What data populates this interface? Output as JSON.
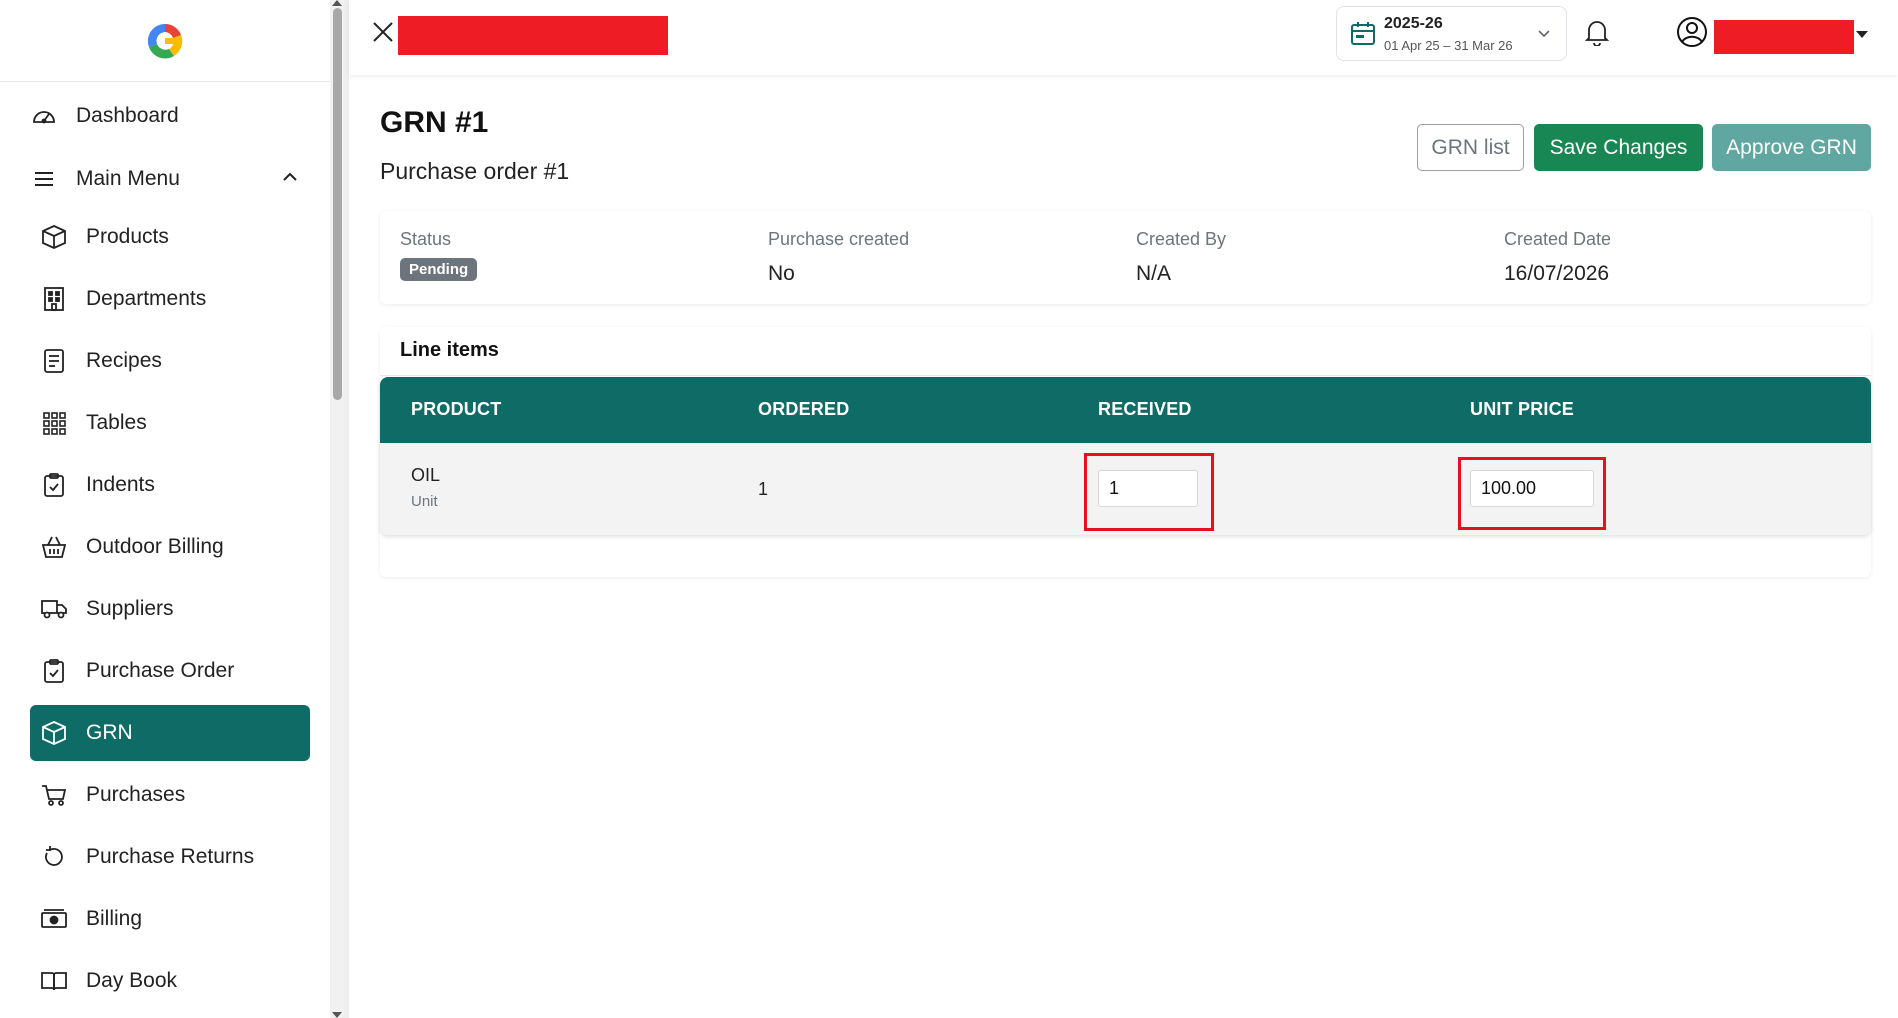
{
  "sidebar": {
    "dashboard": "Dashboard",
    "main_menu": "Main Menu",
    "items": [
      {
        "label": "Products",
        "icon": "box-icon"
      },
      {
        "label": "Departments",
        "icon": "building-icon"
      },
      {
        "label": "Recipes",
        "icon": "recipe-icon"
      },
      {
        "label": "Tables",
        "icon": "grid-icon"
      },
      {
        "label": "Indents",
        "icon": "clipboard-icon"
      },
      {
        "label": "Outdoor Billing",
        "icon": "basket-icon"
      },
      {
        "label": "Suppliers",
        "icon": "truck-icon"
      },
      {
        "label": "Purchase Order",
        "icon": "clipboard-check-icon"
      },
      {
        "label": "GRN",
        "icon": "box-icon",
        "active": true
      },
      {
        "label": "Purchases",
        "icon": "cart-icon"
      },
      {
        "label": "Purchase Returns",
        "icon": "return-icon"
      },
      {
        "label": "Billing",
        "icon": "cash-icon"
      },
      {
        "label": "Day Book",
        "icon": "book-icon"
      }
    ]
  },
  "topbar": {
    "fy_title": "2025-26",
    "fy_range": "01 Apr 25 – 31 Mar 26"
  },
  "page": {
    "title": "GRN #1",
    "subtitle": "Purchase order #1",
    "buttons": {
      "grn_list": "GRN list",
      "save": "Save Changes",
      "approve": "Approve GRN"
    }
  },
  "info": {
    "status_label": "Status",
    "status_value": "Pending",
    "purchase_created_label": "Purchase created",
    "purchase_created_value": "No",
    "created_by_label": "Created By",
    "created_by_value": "N/A",
    "created_date_label": "Created Date",
    "created_date_value": "16/07/2026"
  },
  "line_items": {
    "title": "Line items",
    "columns": [
      "PRODUCT",
      "ORDERED",
      "RECEIVED",
      "UNIT PRICE"
    ],
    "rows": [
      {
        "product": "OIL",
        "unit": "Unit",
        "ordered": "1",
        "received": "1",
        "unit_price": "100.00"
      }
    ]
  },
  "colors": {
    "primary_teal": "#0e6b66",
    "save_green": "#198754",
    "approve_teal": "#5fa7a0",
    "redaction_red": "#ee1c25",
    "highlight_red": "#e5111d"
  }
}
